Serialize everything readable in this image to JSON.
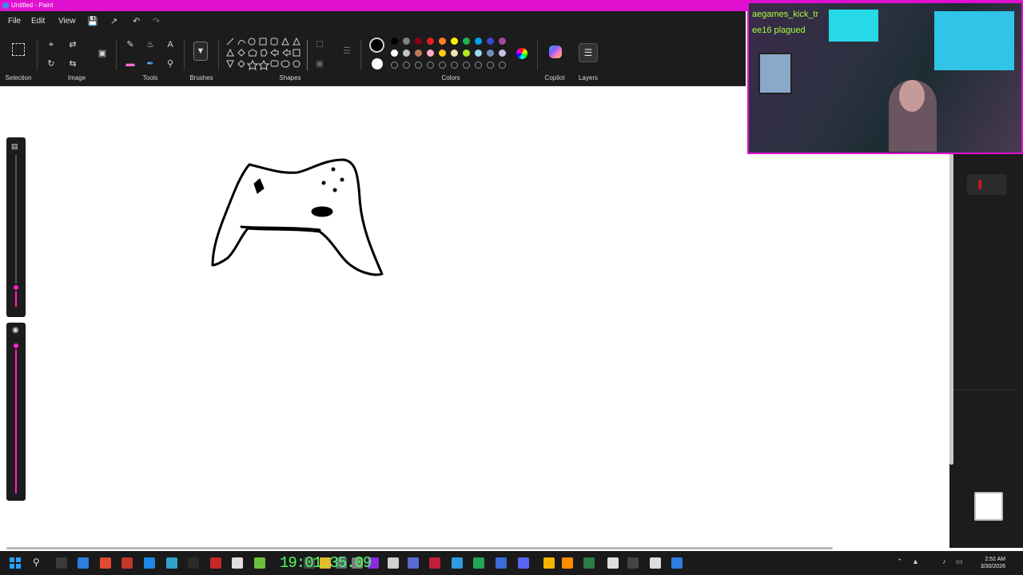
{
  "window": {
    "title": "Untitled - Paint"
  },
  "menu": {
    "file": "File",
    "edit": "Edit",
    "view": "View"
  },
  "ribbon": {
    "groups": {
      "selection": "Selection",
      "image": "Image",
      "tools": "Tools",
      "brushes": "Brushes",
      "shapes": "Shapes",
      "colors": "Colors",
      "copilot": "Copilot",
      "layers": "Layers"
    },
    "text_tool_glyph": "A",
    "colors_row1": [
      "#000000",
      "#7f7f7f",
      "#880015",
      "#ed1c24",
      "#ff7f27",
      "#fff200",
      "#22b14c",
      "#00a2e8",
      "#3f48cc",
      "#a349a4"
    ],
    "colors_row2": [
      "#ffffff",
      "#c3c3c3",
      "#b97a57",
      "#ffaec9",
      "#ffc90e",
      "#efe4b0",
      "#b5e61d",
      "#99d9ea",
      "#7092be",
      "#c8bfe7"
    ],
    "primary_color": "#000000",
    "secondary_color": "#ffffff"
  },
  "overlay": {
    "stream_text_1": "aegames_kick_tr",
    "stream_text_2": "ee16 plagued",
    "timer": "19:01:35.09"
  },
  "taskbar": {
    "time": "2:52 AM",
    "date": "3/30/2026"
  },
  "colors": {
    "accent": "#e010d0",
    "slider_accent": "#ff1fcf",
    "ribbon_bg": "#1c1c1c"
  }
}
